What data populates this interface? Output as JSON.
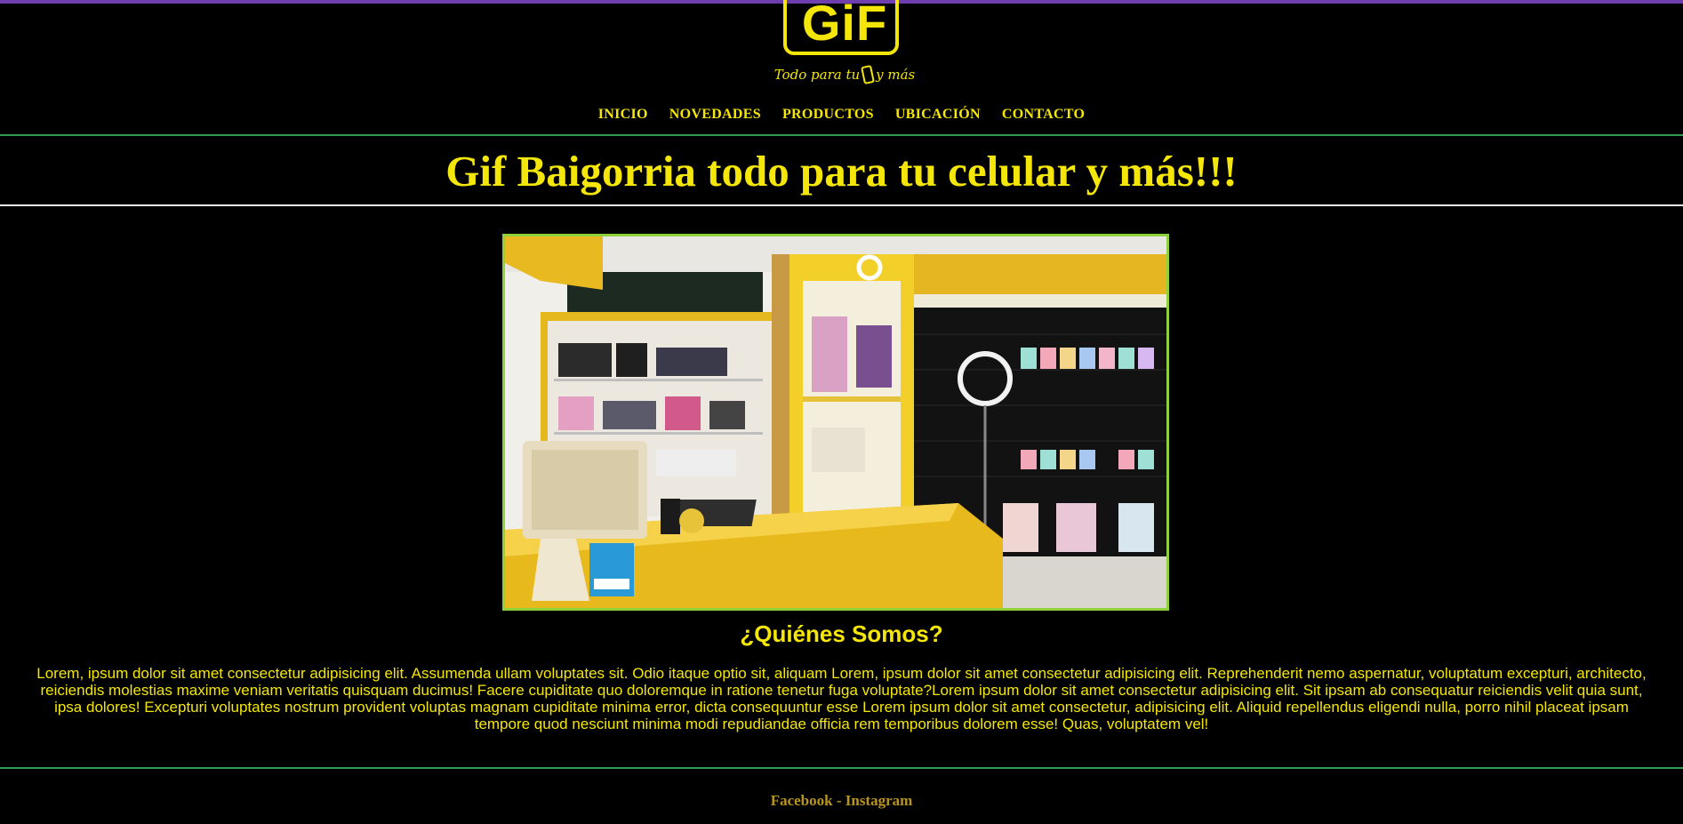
{
  "brand": {
    "logo_text": "GiF",
    "tagline_pre": "Todo para tu",
    "tagline_post": "y más"
  },
  "nav": {
    "items": [
      {
        "label": "INICIO"
      },
      {
        "label": "NOVEDADES"
      },
      {
        "label": "PRODUCTOS"
      },
      {
        "label": "UBICACIÓN"
      },
      {
        "label": "CONTACTO"
      }
    ]
  },
  "main": {
    "title": "Gif Baigorria todo para tu celular y más!!!",
    "photo_alt": "Store interior",
    "about_heading": "¿Quiénes Somos?",
    "about_text": "Lorem, ipsum dolor sit amet consectetur adipisicing elit. Assumenda ullam voluptates sit. Odio itaque optio sit, aliquam Lorem, ipsum dolor sit amet consectetur adipisicing elit. Reprehenderit nemo aspernatur, voluptatum excepturi, architecto, reiciendis molestias maxime veniam veritatis quisquam ducimus! Facere cupiditate quo doloremque in ratione tenetur fuga voluptate?Lorem ipsum dolor sit amet consectetur adipisicing elit. Sit ipsam ab consequatur reiciendis velit quia sunt, ipsa dolores! Excepturi voluptates nostrum provident voluptas magnam cupiditate minima error, dicta consequuntur esse Lorem ipsum dolor sit amet consectetur, adipisicing elit. Aliquid repellendus eligendi nulla, porro nihil placeat ipsam tempore quod nesciunt minima modi repudiandae officia rem temporibus dolorem esse! Quas, voluptatem vel!"
  },
  "footer": {
    "facebook": "Facebook",
    "separator": " - ",
    "instagram": "Instagram"
  },
  "colors": {
    "background": "#000000",
    "accent_yellow": "#f5e60a",
    "footer_link": "#b8941f",
    "rule_green": "#2e9d4f",
    "photo_border": "#8fd13a",
    "top_bar": "#6f3fb0"
  }
}
